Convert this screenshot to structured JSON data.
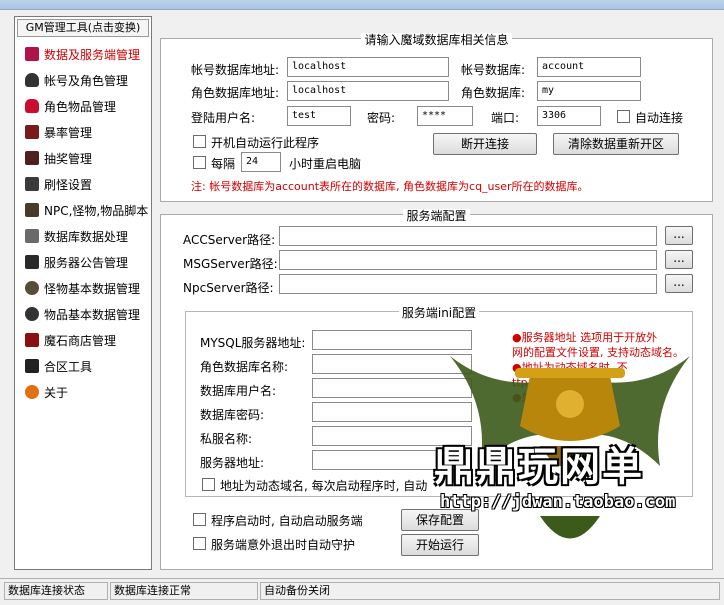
{
  "sidebar": {
    "header": "GM管理工具(点击变换)",
    "items": [
      {
        "label": "数据及服务端管理",
        "icon": "book-icon",
        "active": true
      },
      {
        "label": "帐号及角色管理",
        "icon": "user-icon"
      },
      {
        "label": "角色物品管理",
        "icon": "bag-icon"
      },
      {
        "label": "暴率管理",
        "icon": "hand-icon"
      },
      {
        "label": "抽奖管理",
        "icon": "dice-icon"
      },
      {
        "label": "刷怪设置",
        "icon": "sword-icon"
      },
      {
        "label": "NPC,怪物,物品脚本",
        "icon": "npc-icon"
      },
      {
        "label": "数据库数据处理",
        "icon": "database-icon"
      },
      {
        "label": "服务器公告管理",
        "icon": "announce-icon"
      },
      {
        "label": "怪物基本数据管理",
        "icon": "monster-icon"
      },
      {
        "label": "物品基本数据管理",
        "icon": "item-icon"
      },
      {
        "label": "魔石商店管理",
        "icon": "shop-icon"
      },
      {
        "label": "合区工具",
        "icon": "merge-icon"
      },
      {
        "label": "关于",
        "icon": "about-icon"
      }
    ]
  },
  "db": {
    "title": "请输入魔域数据库相关信息",
    "account_addr_label": "帐号数据库地址:",
    "account_addr_value": "localhost",
    "account_db_label": "帐号数据库:",
    "account_db_value": "account",
    "role_addr_label": "角色数据库地址:",
    "role_addr_value": "localhost",
    "role_db_label": "角色数据库:",
    "role_db_value": "my",
    "user_label": "登陆用户名:",
    "user_value": "test",
    "password_label": "密码:",
    "password_value": "****",
    "port_label": "端口:",
    "port_value": "3306",
    "auto_connect_label": "自动连接",
    "autorun_label": "开机自动运行此程序",
    "every_label": "每隔",
    "hours_value": "24",
    "hours_suffix": "小时重启电脑",
    "disconnect_btn": "断开连接",
    "clear_btn": "清除数据重新开区",
    "note": "注: 帐号数据库为account表所在的数据库, 角色数据库为cq_user所在的数据库。"
  },
  "server": {
    "title": "服务端配置",
    "acc_label": "ACCServer路径:",
    "msg_label": "MSGServer路径:",
    "npc_label": "NpcServer路径:",
    "browse": "...",
    "ini": {
      "title": "服务端ini配置",
      "mysql_label": "MYSQL服务器地址:",
      "roledb_label": "角色数据库名称:",
      "dbuser_label": "数据库用户名:",
      "dbpass_label": "数据库密码:",
      "private_label": "私服名称:",
      "server_label": "服务器地址:",
      "dynamic_label": "地址为动态域名, 每次启动程序时, 自动",
      "notes": [
        "●服务器地址 选项用于开放外",
        "网的配置文件设置, 支持动态域名。",
        "●地址为动态域名时, 不",
        "ttp://。",
        "●如果"
      ]
    },
    "autostart_label": "程序启动时, 自动启动服务端",
    "guard_label": "服务端意外退出时自动守护",
    "save_btn": "保存配置",
    "start_btn": "开始运行"
  },
  "status": {
    "cell1": "数据库连接状态",
    "cell2": "数据库连接正常",
    "cell3": "自动备份关闭"
  },
  "watermark": {
    "title": "鼎鼎玩网单",
    "url": "http://jdwan.taobao.com"
  }
}
